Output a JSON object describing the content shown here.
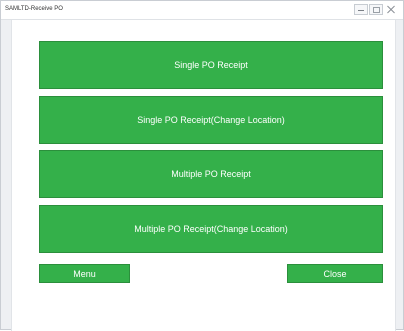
{
  "window": {
    "title": "SAMLTD-Receive PO"
  },
  "buttons": {
    "single_po": "Single PO Receipt",
    "single_po_change_location": "Single PO Receipt(Change Location)",
    "multiple_po": "Multiple PO Receipt",
    "multiple_po_change_location": "Multiple PO Receipt(Change Location)",
    "menu": "Menu",
    "close": "Close"
  },
  "colors": {
    "button_green": "#34b04a",
    "button_border": "#2b8f3c",
    "button_text": "#ffffff",
    "window_bg": "#eef0f3",
    "client_bg": "#ffffff"
  }
}
